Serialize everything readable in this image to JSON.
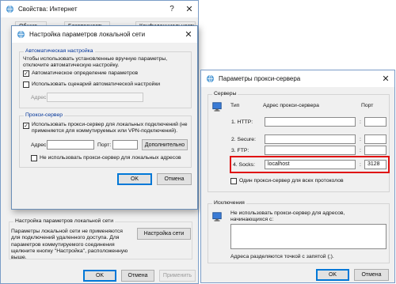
{
  "main_window": {
    "title": "Свойства: Интернет",
    "tabs": [
      "Общие",
      "Безопасность",
      "Конфиденциальность"
    ],
    "lan_section_title": "Настройка параметров локальной сети",
    "lan_section_text": "Параметры локальной сети не применяются для подключений удаленного доступа. Для параметров коммутируемого соединения щелкните кнопку \"Настройка\", расположенную выше.",
    "lan_settings_button": "Настройка сети",
    "ok": "OK",
    "cancel": "Отмена",
    "apply": "Применить"
  },
  "lan_dialog": {
    "title": "Настройка параметров локальной сети",
    "auto_group": "Автоматическая настройка",
    "auto_desc": "Чтобы использовать установленные вручную параметры, отключите автоматическую настройку.",
    "auto_detect_label": "Автоматическое определение параметров",
    "auto_detect_checked": true,
    "auto_script_label": "Использовать сценарий автоматической настройки",
    "auto_script_checked": false,
    "address_label": "Адрес",
    "proxy_group": "Прокси-сервер",
    "use_proxy_label": "Использовать прокси-сервер для локальных подключений (не применяется для коммутируемых или VPN-подключений).",
    "use_proxy_checked": true,
    "proxy_address_label": "Адрес:",
    "proxy_port_label": "Порт:",
    "advanced_button": "Дополнительно",
    "bypass_local_label": "Не использовать прокси-сервер для локальных адресов",
    "bypass_local_checked": false,
    "ok": "OK",
    "cancel": "Отмена"
  },
  "proxy_dialog": {
    "title": "Параметры прокси-сервера",
    "servers_group": "Серверы",
    "col_type": "Тип",
    "col_address": "Адрес прокси-сервера",
    "col_port": "Порт",
    "rows": [
      {
        "type": "1. HTTP:",
        "address": "",
        "port": ""
      },
      {
        "type": "2. Secure:",
        "address": "",
        "port": ""
      },
      {
        "type": "3. FTP:",
        "address": "",
        "port": ""
      },
      {
        "type": "4. Socks:",
        "address": "localhost",
        "port": "3128"
      }
    ],
    "same_proxy_label": "Один прокси-сервер для всех протоколов",
    "same_proxy_checked": false,
    "exceptions_group": "Исключения",
    "exceptions_desc": "Не использовать прокси-сервер для адресов, начинающихся с:",
    "exceptions_hint": "Адреса разделяются точкой с запятой (;).",
    "ok": "OK",
    "cancel": "Отмена",
    "highlight_color": "#e01010"
  },
  "icons": {
    "globe": "globe-network-icon",
    "proxy_a": "computer-network-icon",
    "proxy_b": "computer-network-icon"
  }
}
